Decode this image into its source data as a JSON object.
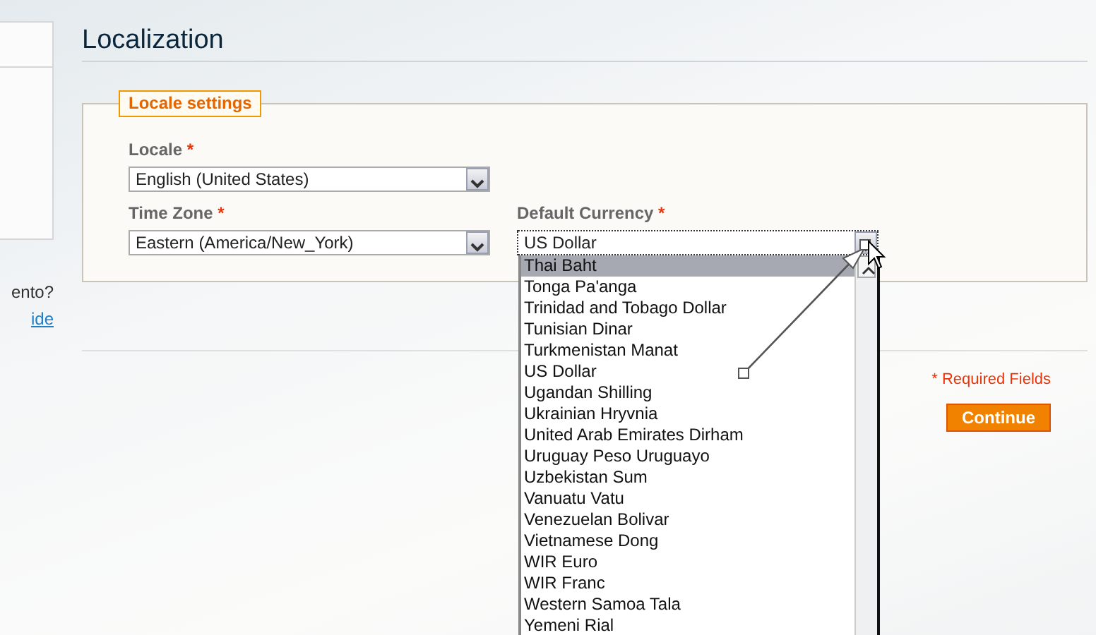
{
  "sidebar": {
    "texts": [
      {
        "text": "ento?",
        "kind": "plain"
      },
      {
        "text": "ide",
        "kind": "link"
      }
    ]
  },
  "page_title": "Localization",
  "fieldset": {
    "legend": "Locale settings",
    "fields": [
      {
        "label": "Locale",
        "required_mark": "*",
        "value": "English (United States)"
      },
      {
        "label": "Time Zone",
        "required_mark": "*",
        "value": "Eastern (America/New_York)"
      },
      {
        "label": "Default Currency",
        "required_mark": "*",
        "value": "US Dollar",
        "expanded": true
      }
    ]
  },
  "currency_options": [
    {
      "label": "Thai Baht",
      "selected": true
    },
    {
      "label": "Tonga Pa'anga",
      "selected": false
    },
    {
      "label": "Trinidad and Tobago Dollar",
      "selected": false
    },
    {
      "label": "Tunisian Dinar",
      "selected": false
    },
    {
      "label": "Turkmenistan Manat",
      "selected": false
    },
    {
      "label": "US Dollar",
      "selected": false
    },
    {
      "label": "Ugandan Shilling",
      "selected": false
    },
    {
      "label": "Ukrainian Hryvnia",
      "selected": false
    },
    {
      "label": "United Arab Emirates Dirham",
      "selected": false
    },
    {
      "label": "Uruguay Peso Uruguayo",
      "selected": false
    },
    {
      "label": "Uzbekistan Sum",
      "selected": false
    },
    {
      "label": "Vanuatu Vatu",
      "selected": false
    },
    {
      "label": "Venezuelan Bolivar",
      "selected": false
    },
    {
      "label": "Vietnamese Dong",
      "selected": false
    },
    {
      "label": "WIR Euro",
      "selected": false
    },
    {
      "label": "WIR Franc",
      "selected": false
    },
    {
      "label": "Western Samoa Tala",
      "selected": false
    },
    {
      "label": "Yemeni Rial",
      "selected": false
    }
  ],
  "required_note": "* Required Fields",
  "continue_button": "Continue"
}
